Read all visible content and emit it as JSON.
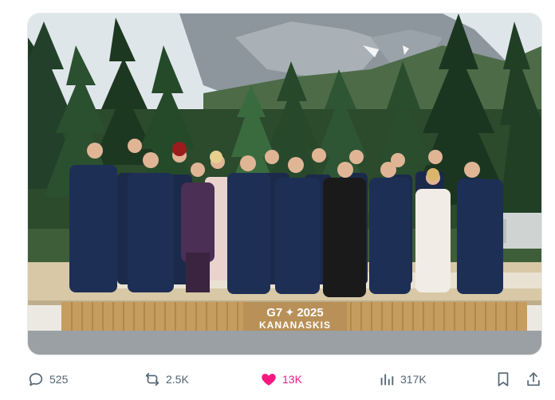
{
  "post": {
    "image": {
      "sign_line1": "G7 ☘ 2025",
      "sign_line1_left": "G7",
      "sign_line1_right": "2025",
      "sign_line2": "KANANASKIS",
      "sign_leaf_icon": "maple-leaf-icon"
    },
    "actions": {
      "reply": {
        "icon": "reply-icon",
        "count": "525"
      },
      "repost": {
        "icon": "repost-icon",
        "count": "2.5K"
      },
      "like": {
        "icon": "heart-icon",
        "count": "13K",
        "active": true,
        "color": "#f91880"
      },
      "views": {
        "icon": "views-icon",
        "count": "317K"
      },
      "bookmark": {
        "icon": "bookmark-icon"
      },
      "share": {
        "icon": "share-icon"
      }
    }
  },
  "colors": {
    "action_grey": "#536471",
    "like_pink": "#f91880",
    "sky": "#e8ecef",
    "forest": "#1f3d24",
    "stage": "#d9c9a8",
    "sign_wood": "#c9a36a"
  }
}
